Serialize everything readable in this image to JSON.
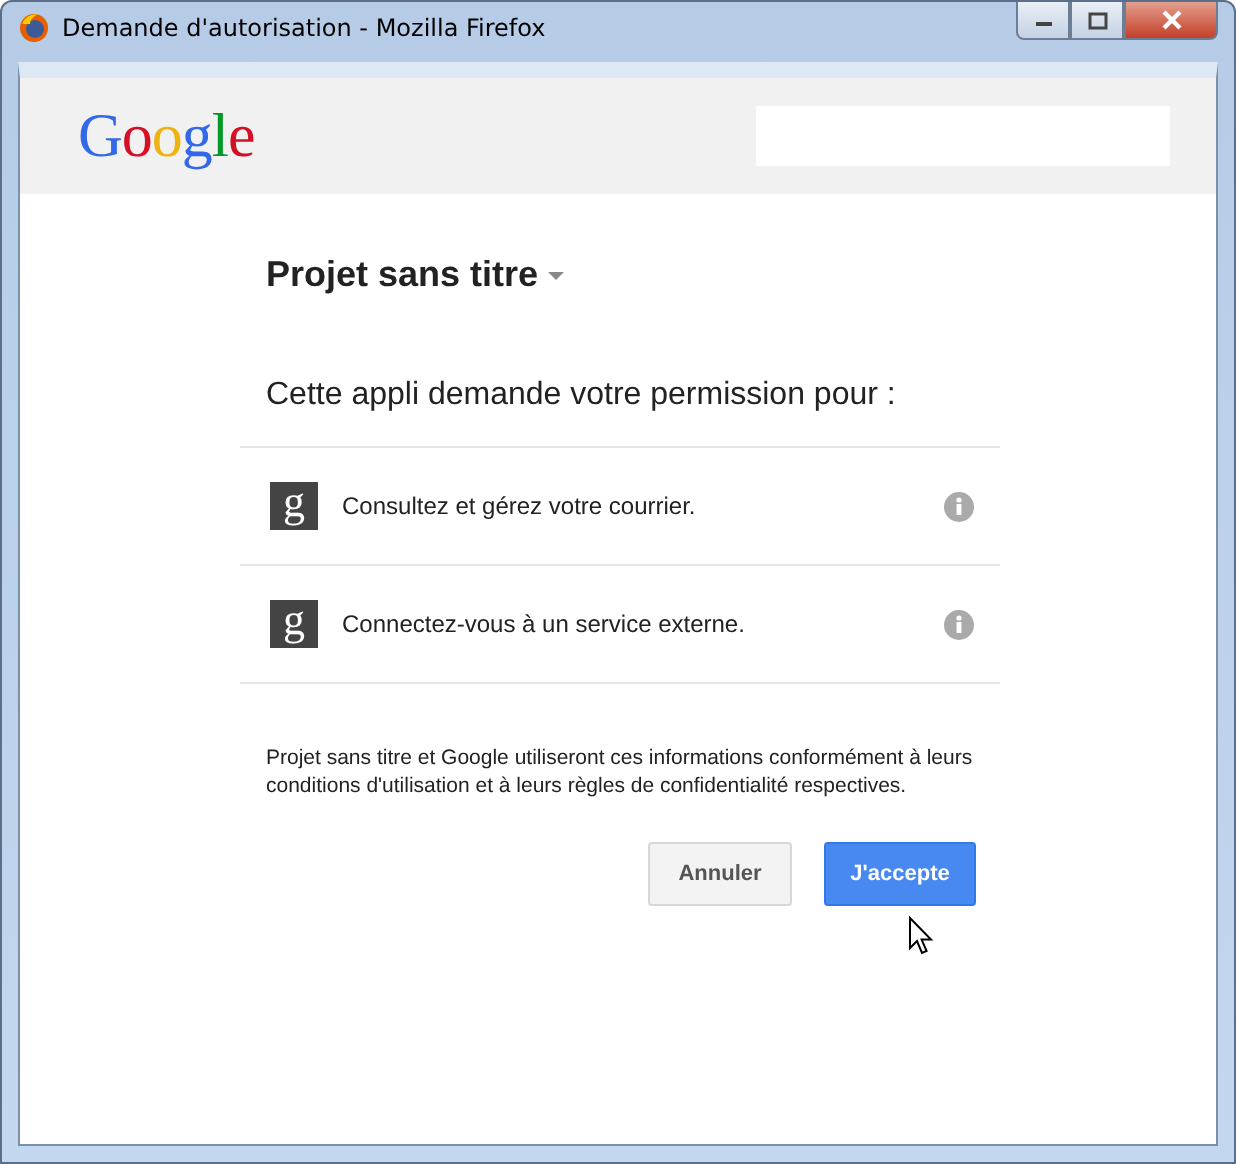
{
  "window": {
    "title": "Demande d'autorisation - Mozilla Firefox"
  },
  "header": {
    "logo": "Google"
  },
  "project": {
    "name": "Projet sans titre"
  },
  "prompt": "Cette appli demande votre permission pour :",
  "permissions": [
    {
      "icon_letter": "g",
      "text": "Consultez et gérez votre courrier."
    },
    {
      "icon_letter": "g",
      "text": "Connectez-vous à un service externe."
    }
  ],
  "legal": "Projet sans titre et Google utiliseront ces informations conformément à leurs conditions d'utilisation et à leurs règles de confidentialité respectives.",
  "buttons": [
    {
      "label": "Annuler",
      "kind": "secondary"
    },
    {
      "label": "J'accepte",
      "kind": "primary"
    }
  ]
}
